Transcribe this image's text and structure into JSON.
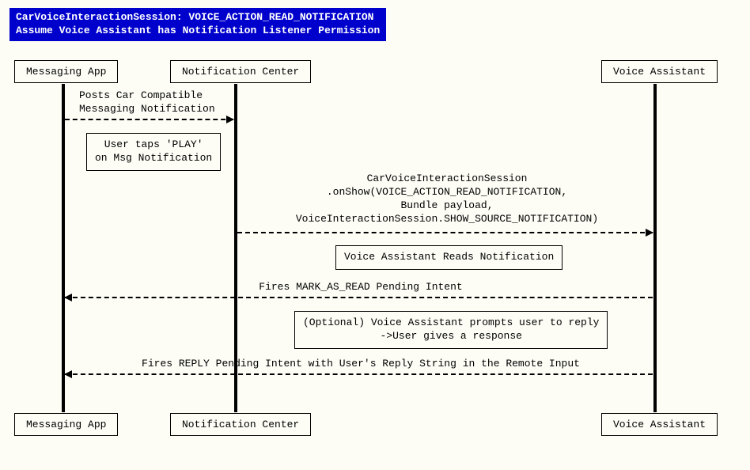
{
  "title": {
    "line1": "CarVoiceInteractionSession: VOICE_ACTION_READ_NOTIFICATION",
    "line2": "Assume Voice Assistant has Notification Listener Permission"
  },
  "participants": {
    "p1": "Messaging App",
    "p2": "Notification Center",
    "p3": "Voice Assistant"
  },
  "messages": {
    "m1_l1": "Posts Car Compatible",
    "m1_l2": "Messaging Notification",
    "m2_l1": "CarVoiceInteractionSession",
    "m2_l2": ".onShow(VOICE_ACTION_READ_NOTIFICATION,",
    "m2_l3": "Bundle payload,",
    "m2_l4": "VoiceInteractionSession.SHOW_SOURCE_NOTIFICATION)",
    "m3": "Fires MARK_AS_READ Pending Intent",
    "m4": "Fires REPLY Pending Intent with User's Reply String in the Remote Input"
  },
  "notes": {
    "n1_l1": "User taps 'PLAY'",
    "n1_l2": "on Msg Notification",
    "n2": "Voice Assistant Reads Notification",
    "n3_l1": "(Optional) Voice Assistant prompts user to reply",
    "n3_l2": "->User gives a response"
  }
}
